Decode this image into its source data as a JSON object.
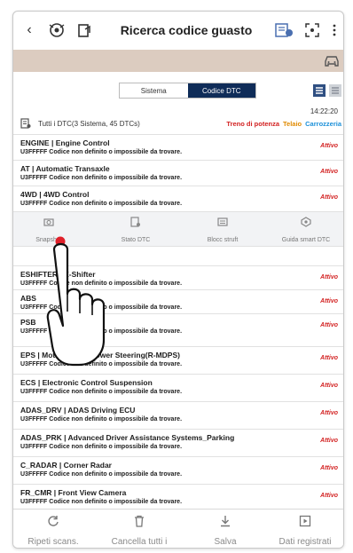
{
  "header": {
    "title": "Ricerca codice guasto"
  },
  "toggle": {
    "sistema": "Sistema",
    "codice": "Codice DTC"
  },
  "summary": {
    "time": "14:22:20",
    "text": "Tutti i DTC(3 Sistema, 45 DTCs)",
    "filters": [
      "Treno di potenza",
      "Telaio",
      "Carrozzeria"
    ]
  },
  "rows": [
    {
      "name": "ENGINE | Engine Control",
      "desc": "U3FFFFF Codice non definito o impossibile da trovare.",
      "status": "Attivo"
    },
    {
      "name": "AT | Automatic Transaxle",
      "desc": "U3FFFFF Codice non definito o impossibile da trovare.",
      "status": "Attivo"
    },
    {
      "name": "4WD | 4WD Control",
      "desc": "U3FFFFF Codice non definito o impossibile da trovare.",
      "status": "Attivo"
    },
    {
      "name": "ESHIFTER | E-Shifter",
      "desc": "U3FFFFF Codice non definito o impossibile da trovare.",
      "status": "Attivo"
    },
    {
      "name": "ABS",
      "desc": "U3FFFFF Codice non definito o impossibile da trovare.",
      "status": "Attivo"
    },
    {
      "name": "PSB",
      "desc": "U3FFFFF Codice non definito o impossibile da trovare.",
      "status": "Attivo"
    },
    {
      "name": "EPS | Motor Driven Power Steering(R-MDPS)",
      "desc": "U3FFFFF Codice non definito o impossibile da trovare.",
      "status": "Attivo"
    },
    {
      "name": "ECS | Electronic Control Suspension",
      "desc": "U3FFFFF Codice non definito o impossibile da trovare.",
      "status": "Attivo"
    },
    {
      "name": "ADAS_DRV | ADAS Driving ECU",
      "desc": "U3FFFFF Codice non definito o impossibile da trovare.",
      "status": "Attivo"
    },
    {
      "name": "ADAS_PRK | Advanced Driver Assistance Systems_Parking",
      "desc": "U3FFFFF Codice non definito o impossibile da trovare.",
      "status": "Attivo"
    },
    {
      "name": "C_RADAR | Corner Radar",
      "desc": "U3FFFFF Codice non definito o impossibile da trovare.",
      "status": "Attivo"
    },
    {
      "name": "FR_CMR | Front View Camera",
      "desc": "U3FFFFF Codice non definito o impossibile da trovare.",
      "status": "Attivo"
    }
  ],
  "actions": [
    {
      "label": "Snapshot",
      "icon": "snapshot-icon"
    },
    {
      "label": "Stato DTC",
      "icon": "dtc-status-icon"
    },
    {
      "label": "Blocc struft",
      "icon": "freeze-frame-icon"
    },
    {
      "label": "Guida smart DTC",
      "icon": "smart-guide-icon"
    }
  ],
  "bottom": [
    {
      "label": "Ripeti scans.",
      "icon": "refresh-icon"
    },
    {
      "label": "Cancella tutti i",
      "icon": "trash-icon"
    },
    {
      "label": "Salva",
      "icon": "download-icon"
    },
    {
      "label": "Dati registrati",
      "icon": "recorded-data-icon"
    }
  ],
  "colors": {
    "accent": "#0f2c58",
    "status": "#d21f1f",
    "beige": "#dcccc0"
  }
}
